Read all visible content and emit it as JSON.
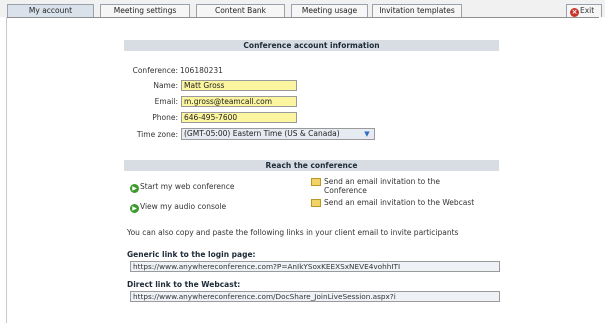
{
  "tabs": [
    {
      "label": "My account",
      "active": true
    },
    {
      "label": "Meeting settings",
      "active": false
    },
    {
      "label": "Content Bank",
      "active": false
    },
    {
      "label": "Meeting usage",
      "active": false
    },
    {
      "label": "Invitation templates",
      "active": false
    }
  ],
  "exit_label": "Exit",
  "account": {
    "header": "Conference account information",
    "conference_label": "Conference:",
    "conference_value": "106180231",
    "name_label": "Name:",
    "name_value": "Matt Gross",
    "email_label": "Email:",
    "email_value": "m.gross@teamcall.com",
    "phone_label": "Phone:",
    "phone_value": "646-495-7600",
    "timezone_label": "Time zone:",
    "timezone_value": "(GMT-05:00) Eastern Time (US & Canada)"
  },
  "reach": {
    "header": "Reach the conference",
    "start_web": "Start my web conference",
    "view_audio": "View my audio console",
    "email_conference": "Send an email invitation to the Conference",
    "email_webcast": "Send an email invitation to the Webcast",
    "copy_text": "You can also copy and paste the following links in your client email to invite participants",
    "generic_label": "Generic link to the login page:",
    "generic_url": "https://www.anywhereconference.com?P=AnIkYSoxKEEXSxNEVE4vohhITI",
    "direct_label": "Direct link to the Webcast:",
    "direct_url": "https://www.anywhereconference.com/DocShare_JoinLiveSession.aspx?i"
  },
  "colors": {
    "field_bg": "#fbf59f",
    "header_bg": "#d7dde3",
    "go_icon": "#3a9a2a",
    "exit_icon": "#c8352b"
  }
}
